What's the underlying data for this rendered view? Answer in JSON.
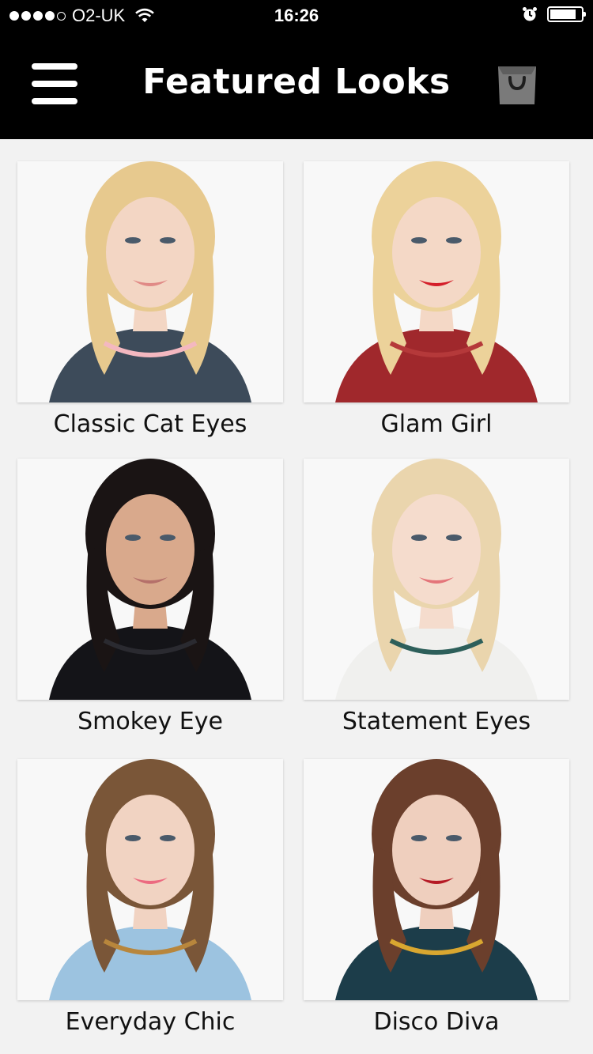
{
  "status_bar": {
    "carrier": "O2-UK",
    "time": "16:26",
    "battery_level": 0.85
  },
  "header": {
    "title": "Featured Looks",
    "menu_icon": "hamburger-menu-icon",
    "bag_icon": "shopping-bag-icon"
  },
  "looks": [
    {
      "label": "Classic Cat Eyes",
      "hair": "#e7c98e",
      "skin": "#f3d6c4",
      "top": "#3d4b5a",
      "accent": "#f4b8c0",
      "lips": "#e08a86"
    },
    {
      "label": "Glam Girl",
      "hair": "#ecd29a",
      "skin": "#f4d8c6",
      "top": "#a0282c",
      "accent": "#b5393a",
      "lips": "#d41f2a"
    },
    {
      "label": "Smokey Eye",
      "hair": "#1a1414",
      "skin": "#d9a98c",
      "top": "#141418",
      "accent": "#2a2a30",
      "lips": "#b5706a"
    },
    {
      "label": "Statement Eyes",
      "hair": "#ead5ad",
      "skin": "#f5dccd",
      "top": "#f0f0ee",
      "accent": "#2d5f5a",
      "lips": "#e4757a"
    },
    {
      "label": "Everyday Chic",
      "hair": "#7a5638",
      "skin": "#f1d3c2",
      "top": "#9cc3e0",
      "accent": "#b8863c",
      "lips": "#ec6a80"
    },
    {
      "label": "Disco Diva",
      "hair": "#6b3f2c",
      "skin": "#efcfbe",
      "top": "#1c3d4a",
      "accent": "#d9a730",
      "lips": "#b51a25"
    }
  ]
}
